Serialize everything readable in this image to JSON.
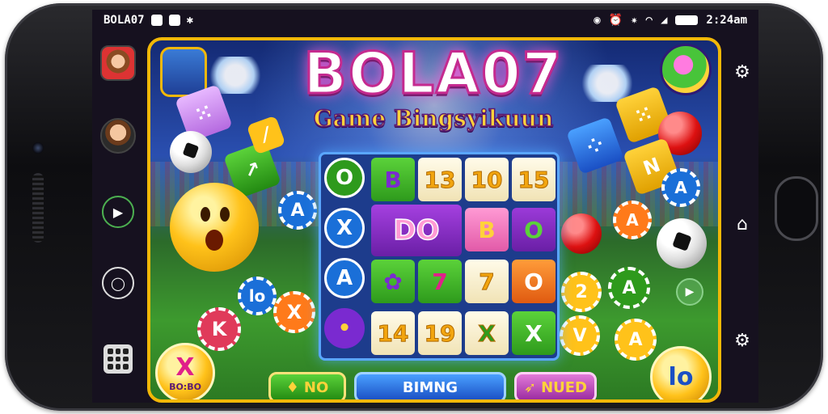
{
  "status_bar": {
    "left_text": "BOLA07",
    "time": "2:24am"
  },
  "game": {
    "logo": "BOLA07",
    "subtitle": "Game Bingsyikuun",
    "board": {
      "left_column": [
        "O",
        "X",
        "A",
        "•"
      ],
      "row1": [
        "B",
        "13",
        "10",
        "15"
      ],
      "row2_big": "DO",
      "row2": [
        "B",
        "O"
      ],
      "row3": [
        "7",
        "7",
        "O"
      ],
      "row4": [
        "14",
        "19",
        "X",
        "X"
      ]
    },
    "chips": {
      "left_a": "A",
      "left_lo": "lo",
      "left_x": "X",
      "left_k": "K",
      "right_a_orange": "A",
      "right_a_blue": "A",
      "right_2": "2",
      "right_a_green": "A",
      "right_v": "V",
      "right_a_yellow": "A",
      "right_a_tile": "A",
      "right_n_tile": "N"
    },
    "bottom_left_coin": {
      "glyph": "X",
      "caption": "BO:BO"
    },
    "bottom_right_coin": "lo",
    "buttons": {
      "no": "NO",
      "bing": "BIMNG",
      "nued": "NUED"
    }
  },
  "colors": {
    "frame_gold": "#f2b807",
    "brand_pink": "#c52a8f",
    "subtitle_yellow": "#ffd23a"
  }
}
